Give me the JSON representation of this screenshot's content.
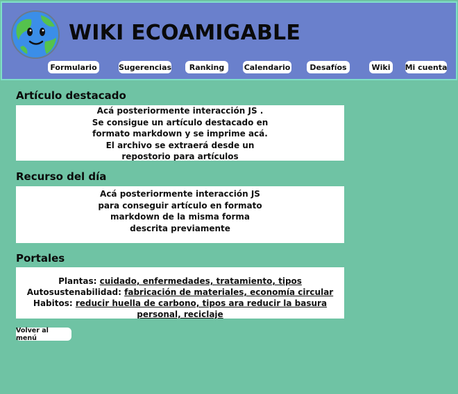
{
  "header": {
    "title": "WIKI ECOAMIGABLE",
    "logo_icon": "earth-globe-icon",
    "colors": {
      "background": "#6a80cc",
      "border": "#7fe0c8"
    }
  },
  "nav": {
    "items": [
      {
        "label": "Formulario"
      },
      {
        "label": "Sugerencias"
      },
      {
        "label": "Ranking"
      },
      {
        "label": "Calendario"
      },
      {
        "label": "Desafíos"
      },
      {
        "label": "Wiki"
      },
      {
        "label": "Mi cuenta"
      }
    ]
  },
  "featured": {
    "title": "Artículo destacado",
    "lines": [
      "Acá posteriormente interacción JS .",
      "Se consigue un artículo destacado en",
      "formato markdown y se imprime acá.",
      "El archivo se extraerá desde un",
      "repostorio para artículos"
    ]
  },
  "resource": {
    "title": "Recurso del día",
    "lines": [
      "Acá posteriormente interacción JS",
      "para conseguir artículo en formato",
      "markdown de la misma forma",
      "descrita previamente"
    ]
  },
  "portals": {
    "title": "Portales",
    "rows": [
      {
        "label": "Plantas:",
        "link": "cuidado, enfermedades, tratamiento, tipos"
      },
      {
        "label": "Autosustenabilidad:",
        "link": "fabricación de materiales, economía circular"
      },
      {
        "label": "Habitos:",
        "link": "reducir huella de carbono, tipos ara reducir la basura personal, reciclaje"
      }
    ]
  },
  "footer": {
    "back_label": "Volver al menú"
  },
  "colors": {
    "page_background": "#6fc3a4",
    "panel_background": "#ffffff"
  }
}
